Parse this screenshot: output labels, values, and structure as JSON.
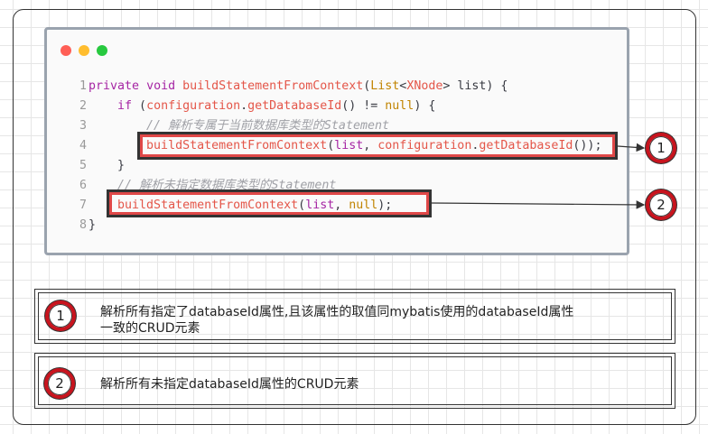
{
  "code": {
    "lines": [
      {
        "n": "1"
      },
      {
        "n": "2"
      },
      {
        "n": "3"
      },
      {
        "n": "4"
      },
      {
        "n": "5"
      },
      {
        "n": "6"
      },
      {
        "n": "7"
      },
      {
        "n": "8"
      }
    ],
    "t": {
      "private": "private",
      "void": "void",
      "method": "buildStatementFromContext",
      "paren": "(",
      "list_type": "List",
      "lt": "<",
      "xnode": "XNode",
      "gt": ">",
      "list_sig": " list) {",
      "if": "if",
      "open": " (",
      "configuration": "configuration",
      "dot": ".",
      "getDb": "getDatabaseId",
      "neq": "() != ",
      "null": "null",
      "close_brace_open": ") {",
      "comment1": "// 解析专属于当前数据库类型的Statement",
      "call": "buildStatementFromContext",
      "list": "list",
      "comma": ", ",
      "end1": "());",
      "rbrace": "}",
      "comment2": "// 解析未指定数据库类型的Statement",
      "end2": ");"
    }
  },
  "callouts": [
    {
      "num": "1"
    },
    {
      "num": "2"
    }
  ],
  "notes": [
    {
      "num": "1",
      "text_line1": "解析所有指定了databaseId属性,且该属性的取值同mybatis使用的databaseId属性",
      "text_line2": "一致的CRUD元素"
    },
    {
      "num": "2",
      "text": "解析所有未指定databaseId属性的CRUD元素"
    }
  ],
  "colors": {
    "highlight": "#e04848",
    "circle": "#c8141e",
    "dot_red": "#ff5f56",
    "dot_yellow": "#ffbd2e",
    "dot_green": "#27c93f"
  }
}
